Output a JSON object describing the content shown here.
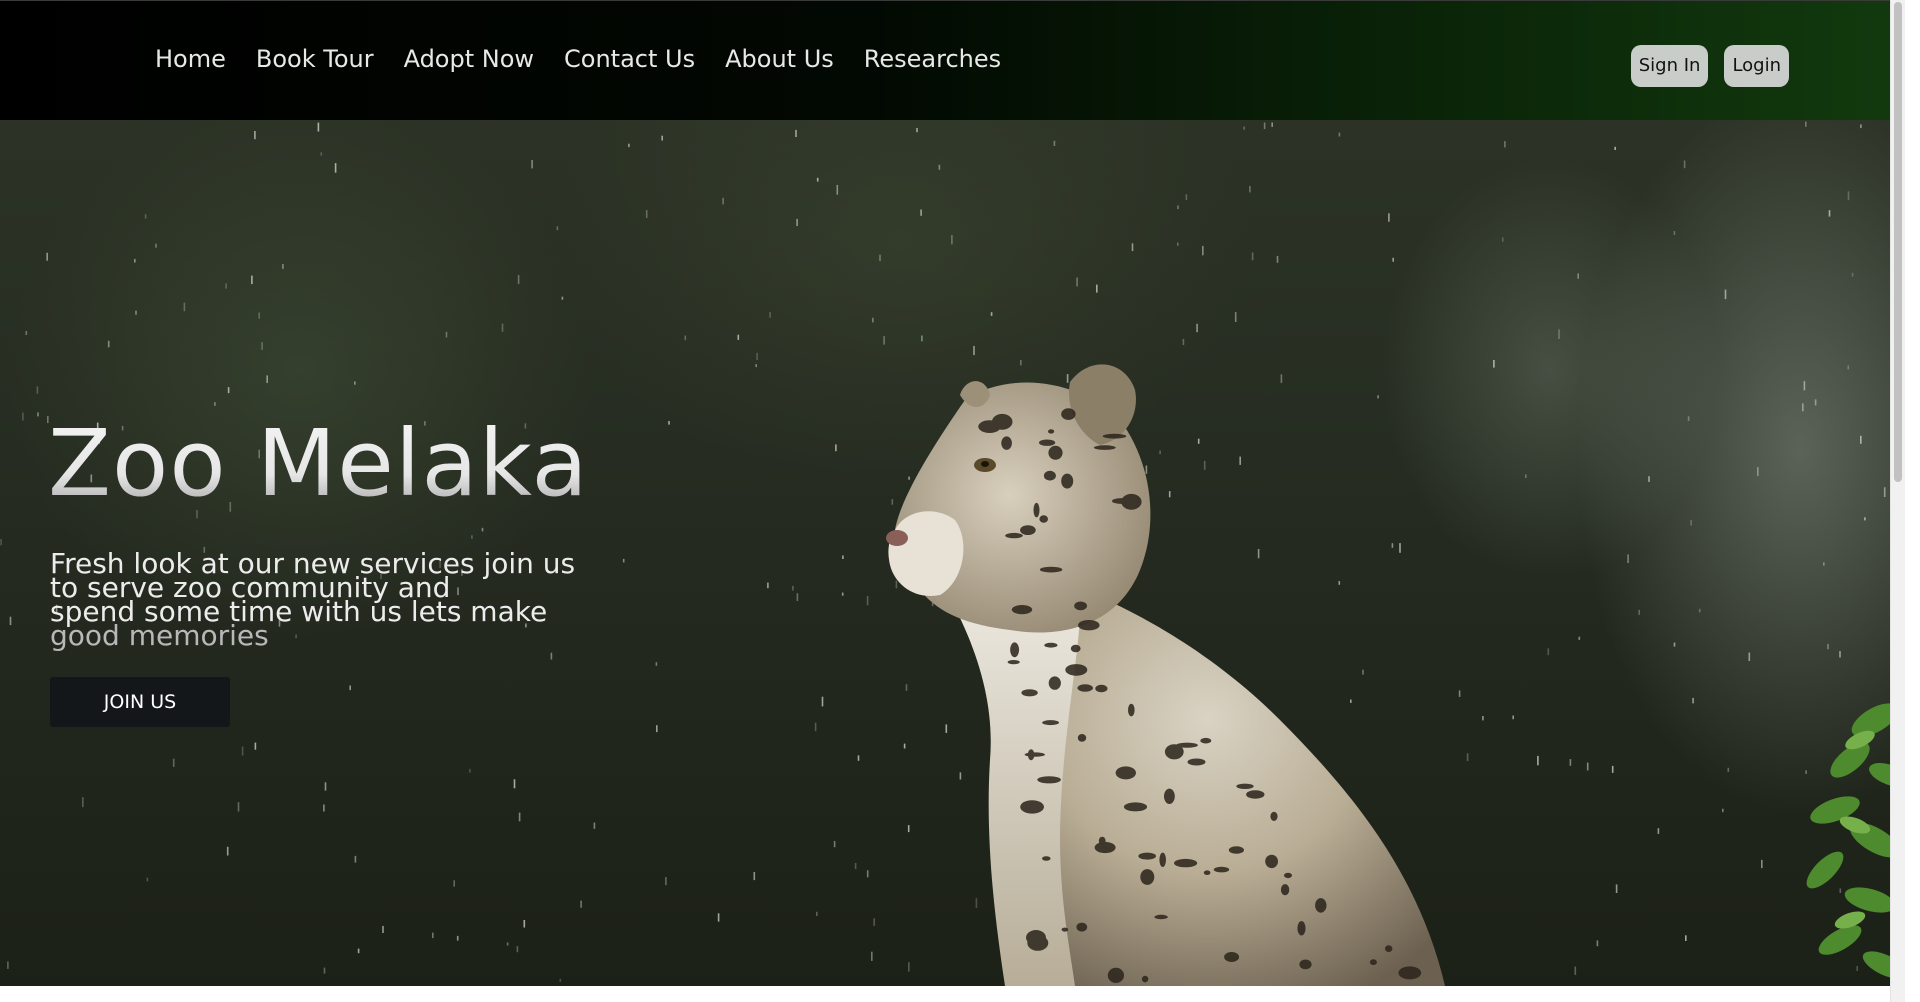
{
  "nav": {
    "items": [
      {
        "label": "Home"
      },
      {
        "label": "Book Tour"
      },
      {
        "label": "Adopt Now"
      },
      {
        "label": "Contact Us"
      },
      {
        "label": "About Us"
      },
      {
        "label": "Researches"
      }
    ],
    "sign_in_label": "Sign In",
    "login_label": "Login"
  },
  "hero": {
    "title": "Zoo Melaka",
    "description_lines": [
      "Fresh look at our new services join us",
      "to serve zoo community and",
      "spend some time with us lets make",
      "good memories"
    ],
    "cta_label": "JOIN US",
    "image_subject": "snow-leopard"
  },
  "colors": {
    "header_start": "#000000",
    "header_end": "#123a0e",
    "auth_button": "#c9cdca",
    "cta_button": "#14171a",
    "hero_text": "#ececec"
  }
}
